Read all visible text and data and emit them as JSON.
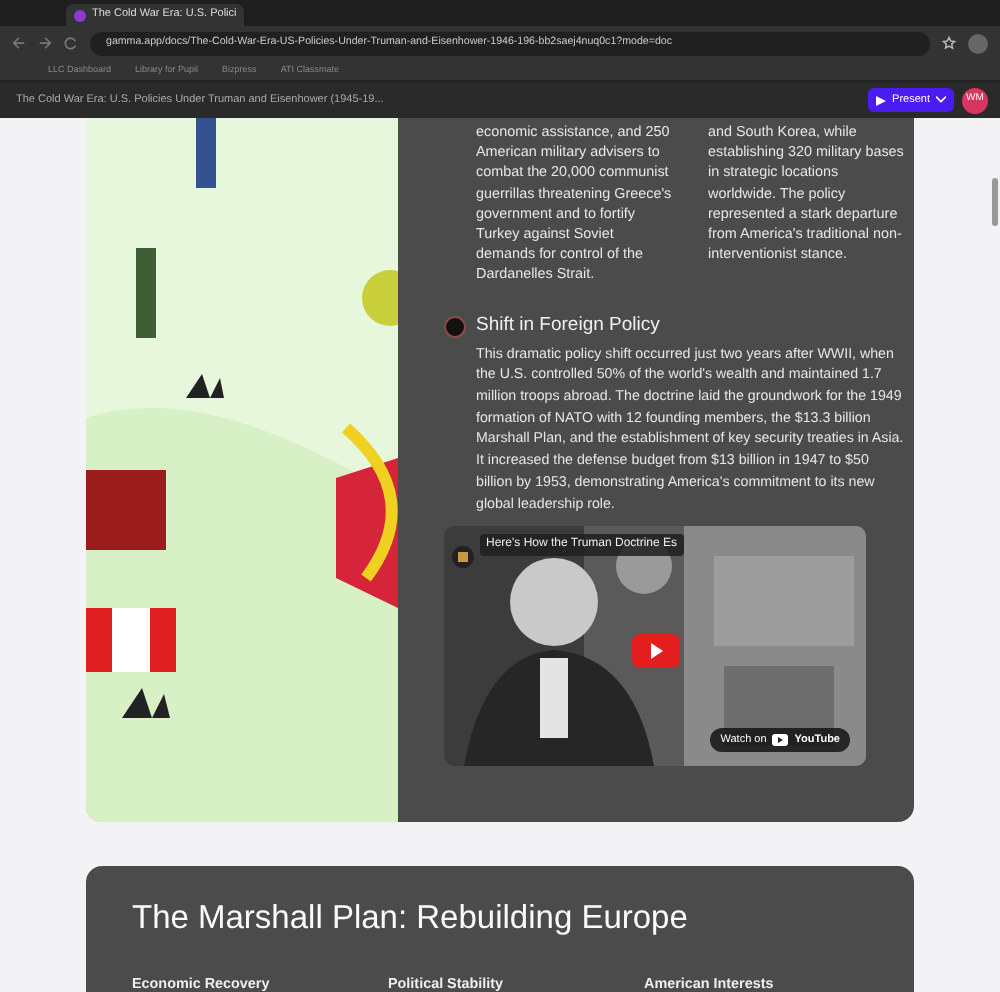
{
  "browser": {
    "tabs": [
      {
        "title": "The Cold War Era: U.S. Polici",
        "selected": true
      }
    ],
    "address": "gamma.app/docs/The-Cold-War-Era-US-Policies-Under-Truman-and-Eisenhower-1946-196-bb2saej4nuq0c1?mode=doc",
    "bookmarks": [
      "LLC Dashboard",
      "Library for Pupil",
      "Bizpress",
      "ATI Classmate"
    ]
  },
  "app_header": {
    "title": "The Cold War Era: U.S. Policies Under Truman and Eisenhower (1945-19...",
    "present_button": "Present",
    "avatar": "WM"
  },
  "section": {
    "columns": [
      "economic assistance, and 250 American military advisers to combat the 20,000 communist guerrillas threatening Greece's government and to fortify Turkey against Soviet demands for control of the Dardanelles Strait.",
      "and South Korea, while establishing 320 military bases in strategic locations worldwide. The policy represented a stark departure from America's traditional non-interventionist stance."
    ],
    "subsection": {
      "heading": "Shift in Foreign Policy",
      "text": "This dramatic policy shift occurred just two years after WWII, when the U.S. controlled 50% of the world's wealth and maintained 1.7 million troops abroad. The doctrine laid the groundwork for the 1949 formation of NATO with 12 founding members, the $13.3 billion Marshall Plan, and the establishment of key security treaties in Asia. It increased the defense budget from $13 billion in 1947 to $50 billion by 1953, demonstrating America's commitment to its new global leadership role."
    },
    "video": {
      "title": "Here's How the Truman Doctrine Es",
      "watch_label": "Watch on",
      "platform": "YouTube"
    }
  },
  "next_section": {
    "title": "The Marshall Plan: Rebuilding Europe",
    "columns": [
      "Economic Recovery",
      "Political Stability",
      "American Interests"
    ]
  }
}
